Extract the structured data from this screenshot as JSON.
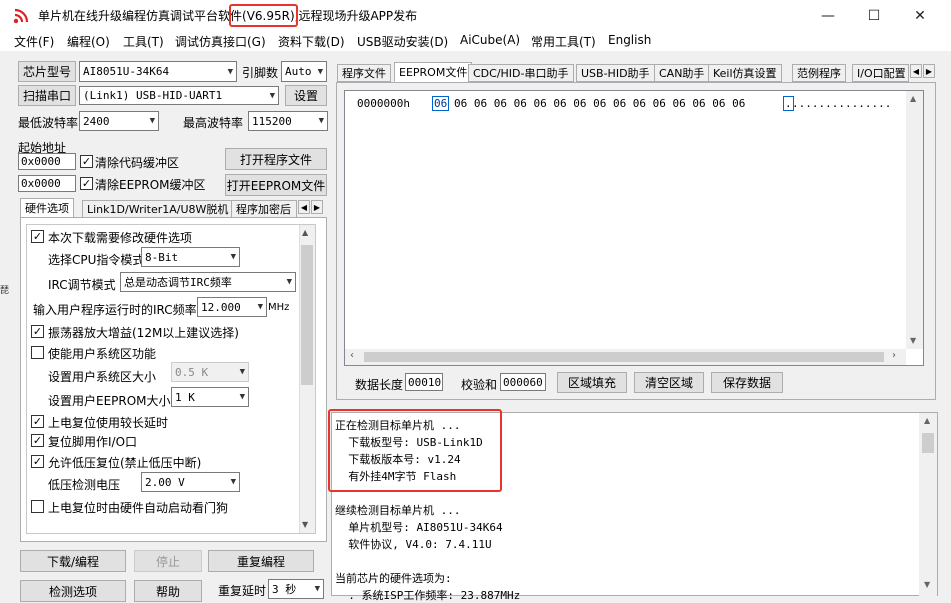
{
  "window": {
    "title_prefix": "单片机在线升级编程仿真调试平台软件",
    "version": "(V6.95R),",
    "title_suffix": "远程现场升级APP发布",
    "minimize": "—",
    "maximize": "☐",
    "close": "✕"
  },
  "menu": [
    "文件(F)",
    "编程(O)",
    "工具(T)",
    "调试仿真接口(G)",
    "资料下载(D)",
    "USB驱动安装(D)",
    "AiCube(A)",
    "常用工具(T)",
    "English"
  ],
  "left": {
    "chip_btn": "芯片型号",
    "chip_value": "AI8051U-34K64",
    "pins_label": "引脚数",
    "pins_value": "Auto",
    "scan_btn": "扫描串口",
    "port_value": "(Link1) USB-HID-UART1",
    "settings_btn": "设置",
    "min_baud_label": "最低波特率",
    "min_baud_value": "2400",
    "max_baud_label": "最高波特率",
    "max_baud_value": "115200",
    "start_addr_label": "起始地址",
    "addr1": "0x0000",
    "clear_code_label": "清除代码缓冲区",
    "open_prog_btn": "打开程序文件",
    "addr2": "0x0000",
    "clear_eeprom_label": "清除EEPROM缓冲区",
    "open_eeprom_btn": "打开EEPROM文件",
    "tabs": [
      "硬件选项",
      "Link1D/Writer1A/U8W脱机",
      "程序加密后"
    ],
    "hw": {
      "opt1": "本次下载需要修改硬件选项",
      "cpu_mode_label": "选择CPU指令模式",
      "cpu_mode_value": "8-Bit",
      "irc_label": "IRC调节模式",
      "irc_value": "总是动态调节IRC频率",
      "freq_label": "输入用户程序运行时的IRC频率",
      "freq_value": "12.000",
      "freq_unit": "MHz",
      "opt2": "振荡器放大增益(12M以上建议选择)",
      "opt3": "使能用户系统区功能",
      "sys_size_label": "设置用户系统区大小",
      "sys_size_value": "0.5 K",
      "eeprom_size_label": "设置用户EEPROM大小",
      "eeprom_size_value": "1   K",
      "opt4": "上电复位使用较长延时",
      "opt5": "复位脚用作I/O口",
      "opt6": "允许低压复位(禁止低压中断)",
      "lvd_label": "低压检测电压",
      "lvd_value": "2.00 V",
      "opt7": "上电复位时由硬件自动启动看门狗"
    },
    "download_btn": "下载/编程",
    "stop_btn": "停止",
    "reprog_btn": "重复编程",
    "detect_btn": "检测选项",
    "help_btn": "帮助",
    "delay_label": "重复延时",
    "delay_value": "3 秒"
  },
  "right": {
    "tabs": [
      "程序文件",
      "EEPROM文件",
      "CDC/HID-串口助手",
      "USB-HID助手",
      "CAN助手",
      "Keil仿真设置",
      "范例程序",
      "I/O口配置"
    ],
    "hex_addr": "0000000h",
    "hex_first": "06",
    "hex_rest": "06 06 06 06 06 06 06 06 06 06 06 06 06 06 06",
    "ascii_first": ".",
    "ascii_rest": "...............",
    "data_len_label": "数据长度",
    "data_len_value": "00010",
    "checksum_label": "校验和",
    "checksum_value": "000060",
    "fill_btn": "区域填充",
    "clear_btn": "清空区域",
    "save_btn": "保存数据",
    "log": [
      "正在检测目标单片机 ...",
      "  下载板型号: USB-Link1D",
      "  下载板版本号: v1.24",
      "  有外挂4M字节 Flash",
      "",
      "继续检测目标单片机 ...",
      "  单片机型号: AI8051U-34K64",
      "  软件协议, V4.0: 7.4.11U",
      "",
      "当前芯片的硬件选项为:",
      "  . 系统ISP工作频率: 23.887MHz"
    ]
  },
  "colors": {
    "highlight": "#e8352b",
    "accent": "#0066cc"
  }
}
